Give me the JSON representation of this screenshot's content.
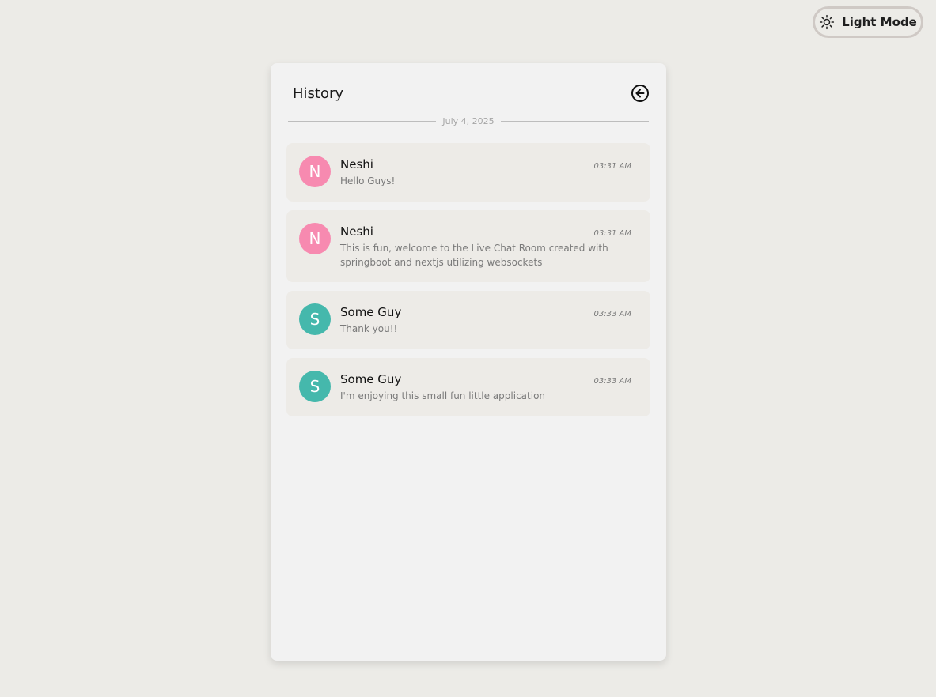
{
  "theme_toggle": {
    "label": "Light Mode",
    "icon": "sun-icon"
  },
  "history": {
    "title": "History",
    "back_icon": "arrow-left-circle-icon",
    "date": "July 4, 2025"
  },
  "messages": [
    {
      "initial": "N",
      "name": "Neshi",
      "time": "03:31 AM",
      "text": "Hello Guys!",
      "color": "#f78ab0"
    },
    {
      "initial": "N",
      "name": "Neshi",
      "time": "03:31 AM",
      "text": "This is fun, welcome to the Live Chat Room created with springboot and nextjs utilizing websockets",
      "color": "#f78ab0"
    },
    {
      "initial": "S",
      "name": "Some Guy",
      "time": "03:33 AM",
      "text": "Thank you!!",
      "color": "#45b8ac"
    },
    {
      "initial": "S",
      "name": "Some Guy",
      "time": "03:33 AM",
      "text": "I'm enjoying this small fun little application",
      "color": "#45b8ac"
    }
  ]
}
